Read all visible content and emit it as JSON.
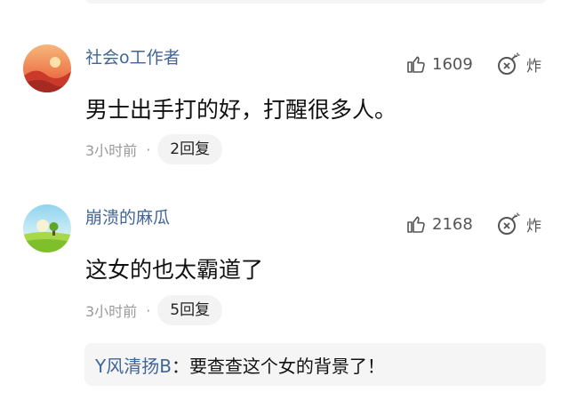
{
  "comments": [
    {
      "username": "社会o工作者",
      "likes": "1609",
      "bomb_label": "炸",
      "text": "男士出手打的好，打醒很多人。",
      "time": "3小时前",
      "dot": "·",
      "replies": "2回复",
      "avatar_icon": "sunset-avatar"
    },
    {
      "username": "崩溃的麻瓜",
      "likes": "2168",
      "bomb_label": "炸",
      "text": "这女的也太霸道了",
      "time": "3小时前",
      "dot": "·",
      "replies": "5回复",
      "avatar_icon": "meadow-avatar"
    }
  ],
  "reply_preview": {
    "user": "Y风清扬B",
    "separator": "：",
    "text": "要查查这个女的背景了！"
  },
  "icons": {
    "like": "thumbs-up-icon",
    "bomb": "bomb-icon"
  },
  "colors": {
    "username": "#406599",
    "meta": "#9a9a9a",
    "pill_bg": "#f3f3f3"
  }
}
